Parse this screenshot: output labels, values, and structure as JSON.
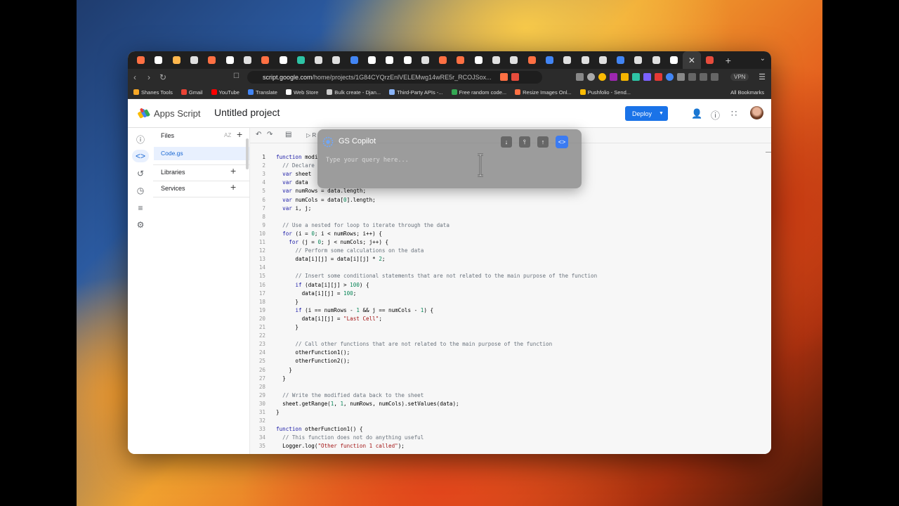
{
  "colors": {
    "accent": "#1a73e8",
    "copilot_accent": "#3b7bf2"
  },
  "browser": {
    "tab_count": 33,
    "tab_favicon_colors": [
      "#ff7043",
      "#ffffff",
      "#ffb74d",
      "#e0e0e0",
      "#ff7043",
      "#ffffff",
      "#e0e0e0",
      "#ff7043",
      "#ffffff",
      "#2ec4a6",
      "#e0e0e0",
      "#e0e0e0",
      "#4285f4",
      "#ffffff",
      "#ffffff",
      "#ffffff",
      "#e0e0e0",
      "#ff7043",
      "#ff7043",
      "#ffffff",
      "#e0e0e0",
      "#e0e0e0",
      "#ff7043",
      "#4285f4",
      "#e0e0e0",
      "#e0e0e0",
      "#e0e0e0",
      "#4285f4",
      "#e0e0e0",
      "#e0e0e0",
      "#ffffff",
      "#ffffff",
      "#e74c3c"
    ],
    "url_host": "script.google.com",
    "url_path": "/home/projects/1G84CYQrzEnlVELEMwg14wRE5r_RCOJSox...",
    "vpn_label": "VPN",
    "bookmarks": [
      {
        "label": "Shanes Tools",
        "color": "#f9a825"
      },
      {
        "label": "Gmail",
        "color": "#ea4335"
      },
      {
        "label": "YouTube",
        "color": "#ff0000"
      },
      {
        "label": "Translate",
        "color": "#4285f4"
      },
      {
        "label": "Web Store",
        "color": "#ffffff"
      },
      {
        "label": "Bulk create - Djan...",
        "color": "#cccccc"
      },
      {
        "label": "Third-Party APIs -...",
        "color": "#8ab4f8"
      },
      {
        "label": "Free random code...",
        "color": "#34a853"
      },
      {
        "label": "Resize Images Onl...",
        "color": "#ff7043"
      },
      {
        "label": "Pushfolio - Send...",
        "color": "#fbbc04"
      }
    ],
    "all_bookmarks_label": "All Bookmarks"
  },
  "header": {
    "app_name": "Apps Script",
    "project_name": "Untitled project",
    "deploy_label": "Deploy"
  },
  "files_panel": {
    "title": "Files",
    "sort_label": "AZ",
    "active_file": "Code.gs",
    "sections": [
      "Libraries",
      "Services"
    ]
  },
  "editor": {
    "run_label": "R",
    "lines": [
      {
        "n": "1",
        "html": "<span class='kw'>function</span> modi"
      },
      {
        "n": "2",
        "html": "  <span class='cm'>// Declare</span>"
      },
      {
        "n": "3",
        "html": "  <span class='kw'>var</span> sheet"
      },
      {
        "n": "4",
        "html": "  <span class='kw'>var</span> data"
      },
      {
        "n": "5",
        "html": "  <span class='kw'>var</span> numRows = data.length;"
      },
      {
        "n": "6",
        "html": "  <span class='kw'>var</span> numCols = data[<span class='nm'>0</span>].length;"
      },
      {
        "n": "7",
        "html": "  <span class='kw'>var</span> i, j;"
      },
      {
        "n": "8",
        "html": ""
      },
      {
        "n": "9",
        "html": "  <span class='cm'>// Use a nested for loop to iterate through the data</span>"
      },
      {
        "n": "10",
        "html": "  <span class='kw'>for</span> (i = <span class='nm'>0</span>; i &lt; numRows; i++) {"
      },
      {
        "n": "11",
        "html": "    <span class='kw'>for</span> (j = <span class='nm'>0</span>; j &lt; numCols; j++) {"
      },
      {
        "n": "12",
        "html": "      <span class='cm'>// Perform some calculations on the data</span>"
      },
      {
        "n": "13",
        "html": "      data[i][j] = data[i][j] * <span class='nm'>2</span>;"
      },
      {
        "n": "14",
        "html": ""
      },
      {
        "n": "15",
        "html": "      <span class='cm'>// Insert some conditional statements that are not related to the main purpose of the function</span>"
      },
      {
        "n": "16",
        "html": "      <span class='kw'>if</span> (data[i][j] &gt; <span class='nm'>100</span>) {"
      },
      {
        "n": "17",
        "html": "        data[i][j] = <span class='nm'>100</span>;"
      },
      {
        "n": "18",
        "html": "      }"
      },
      {
        "n": "19",
        "html": "      <span class='kw'>if</span> (i == numRows - <span class='nm'>1</span> &amp;&amp; j == numCols - <span class='nm'>1</span>) {"
      },
      {
        "n": "20",
        "html": "        data[i][j] = <span class='st'>\"Last Cell\"</span>;"
      },
      {
        "n": "21",
        "html": "      }"
      },
      {
        "n": "22",
        "html": ""
      },
      {
        "n": "23",
        "html": "      <span class='cm'>// Call other functions that are not related to the main purpose of the function</span>"
      },
      {
        "n": "24",
        "html": "      otherFunction1();"
      },
      {
        "n": "25",
        "html": "      otherFunction2();"
      },
      {
        "n": "26",
        "html": "    }"
      },
      {
        "n": "27",
        "html": "  }"
      },
      {
        "n": "28",
        "html": ""
      },
      {
        "n": "29",
        "html": "  <span class='cm'>// Write the modified data back to the sheet</span>"
      },
      {
        "n": "30",
        "html": "  sheet.getRange(<span class='nm'>1</span>, <span class='nm'>1</span>, numRows, numCols).setValues(data);"
      },
      {
        "n": "31",
        "html": "}"
      },
      {
        "n": "32",
        "html": ""
      },
      {
        "n": "33",
        "html": "<span class='kw'>function</span> otherFunction1() {"
      },
      {
        "n": "34",
        "html": "  <span class='cm'>// This function does not do anything useful</span>"
      },
      {
        "n": "35",
        "html": "  Logger.log(<span class='st'>\"Other function 1 called\"</span>);"
      }
    ]
  },
  "copilot": {
    "title": "GS Copilot",
    "placeholder": "Type your query here...",
    "actions": [
      "download-icon",
      "pin-icon",
      "upload-icon",
      "code-icon"
    ]
  }
}
